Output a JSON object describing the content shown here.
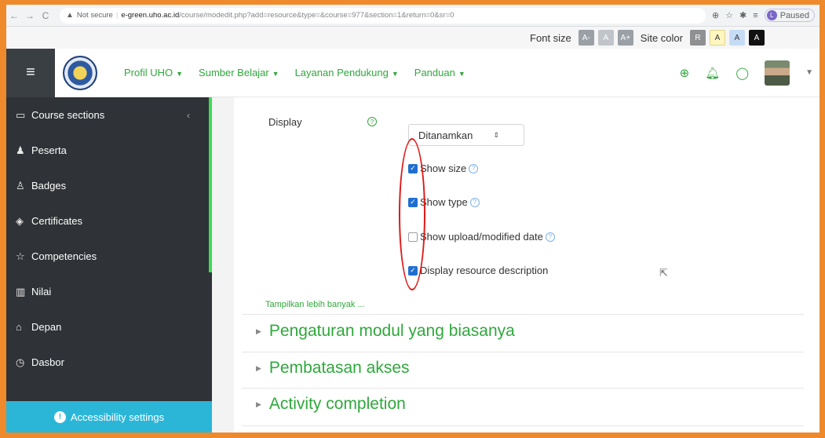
{
  "browser": {
    "security": "Not secure",
    "host": "e-green.uho.ac.id",
    "path": "/course/modedit.php?add=resource&type=&course=977&section=1&return=0&sr=0",
    "profile_status": "Paused",
    "profile_initial": "L"
  },
  "a11y_strip": {
    "font_size_label": "Font size",
    "font_buttons": [
      "A-",
      "A",
      "A+"
    ],
    "site_color_label": "Site color",
    "color_buttons": [
      "R",
      "A",
      "A",
      "A"
    ]
  },
  "navbar": {
    "menu": [
      {
        "label": "Profil UHO"
      },
      {
        "label": "Sumber Belajar"
      },
      {
        "label": "Layanan Pendukung"
      },
      {
        "label": "Panduan"
      }
    ],
    "icons": [
      "globe-icon",
      "bell-icon",
      "chat-icon"
    ]
  },
  "sidebar": {
    "items": [
      {
        "label": "Course sections",
        "icon": "folder-icon"
      },
      {
        "label": "Peserta",
        "icon": "users-icon"
      },
      {
        "label": "Badges",
        "icon": "badge-icon"
      },
      {
        "label": "Certificates",
        "icon": "certificate-icon"
      },
      {
        "label": "Competencies",
        "icon": "star-icon"
      },
      {
        "label": "Nilai",
        "icon": "grades-icon"
      },
      {
        "label": "Depan",
        "icon": "home-icon"
      },
      {
        "label": "Dasbor",
        "icon": "dashboard-icon"
      }
    ],
    "accessibility_button": "Accessibility settings"
  },
  "form": {
    "display_label": "Display",
    "display_value": "Ditanamkan",
    "checkboxes": [
      {
        "label": "Show size",
        "checked": true
      },
      {
        "label": "Show type",
        "checked": true
      },
      {
        "label": "Show upload/modified date",
        "checked": false
      },
      {
        "label": "Display resource description",
        "checked": true
      }
    ],
    "show_more": "Tampilkan lebih banyak ..."
  },
  "sections": [
    {
      "label": "Pengaturan modul yang biasanya"
    },
    {
      "label": "Pembatasan akses"
    },
    {
      "label": "Activity completion"
    }
  ],
  "colors": {
    "accent": "#2fa83c",
    "sidebar_bg": "#2f3236",
    "a11y_button": "#2bb6d8",
    "annotation": "#e01818"
  }
}
